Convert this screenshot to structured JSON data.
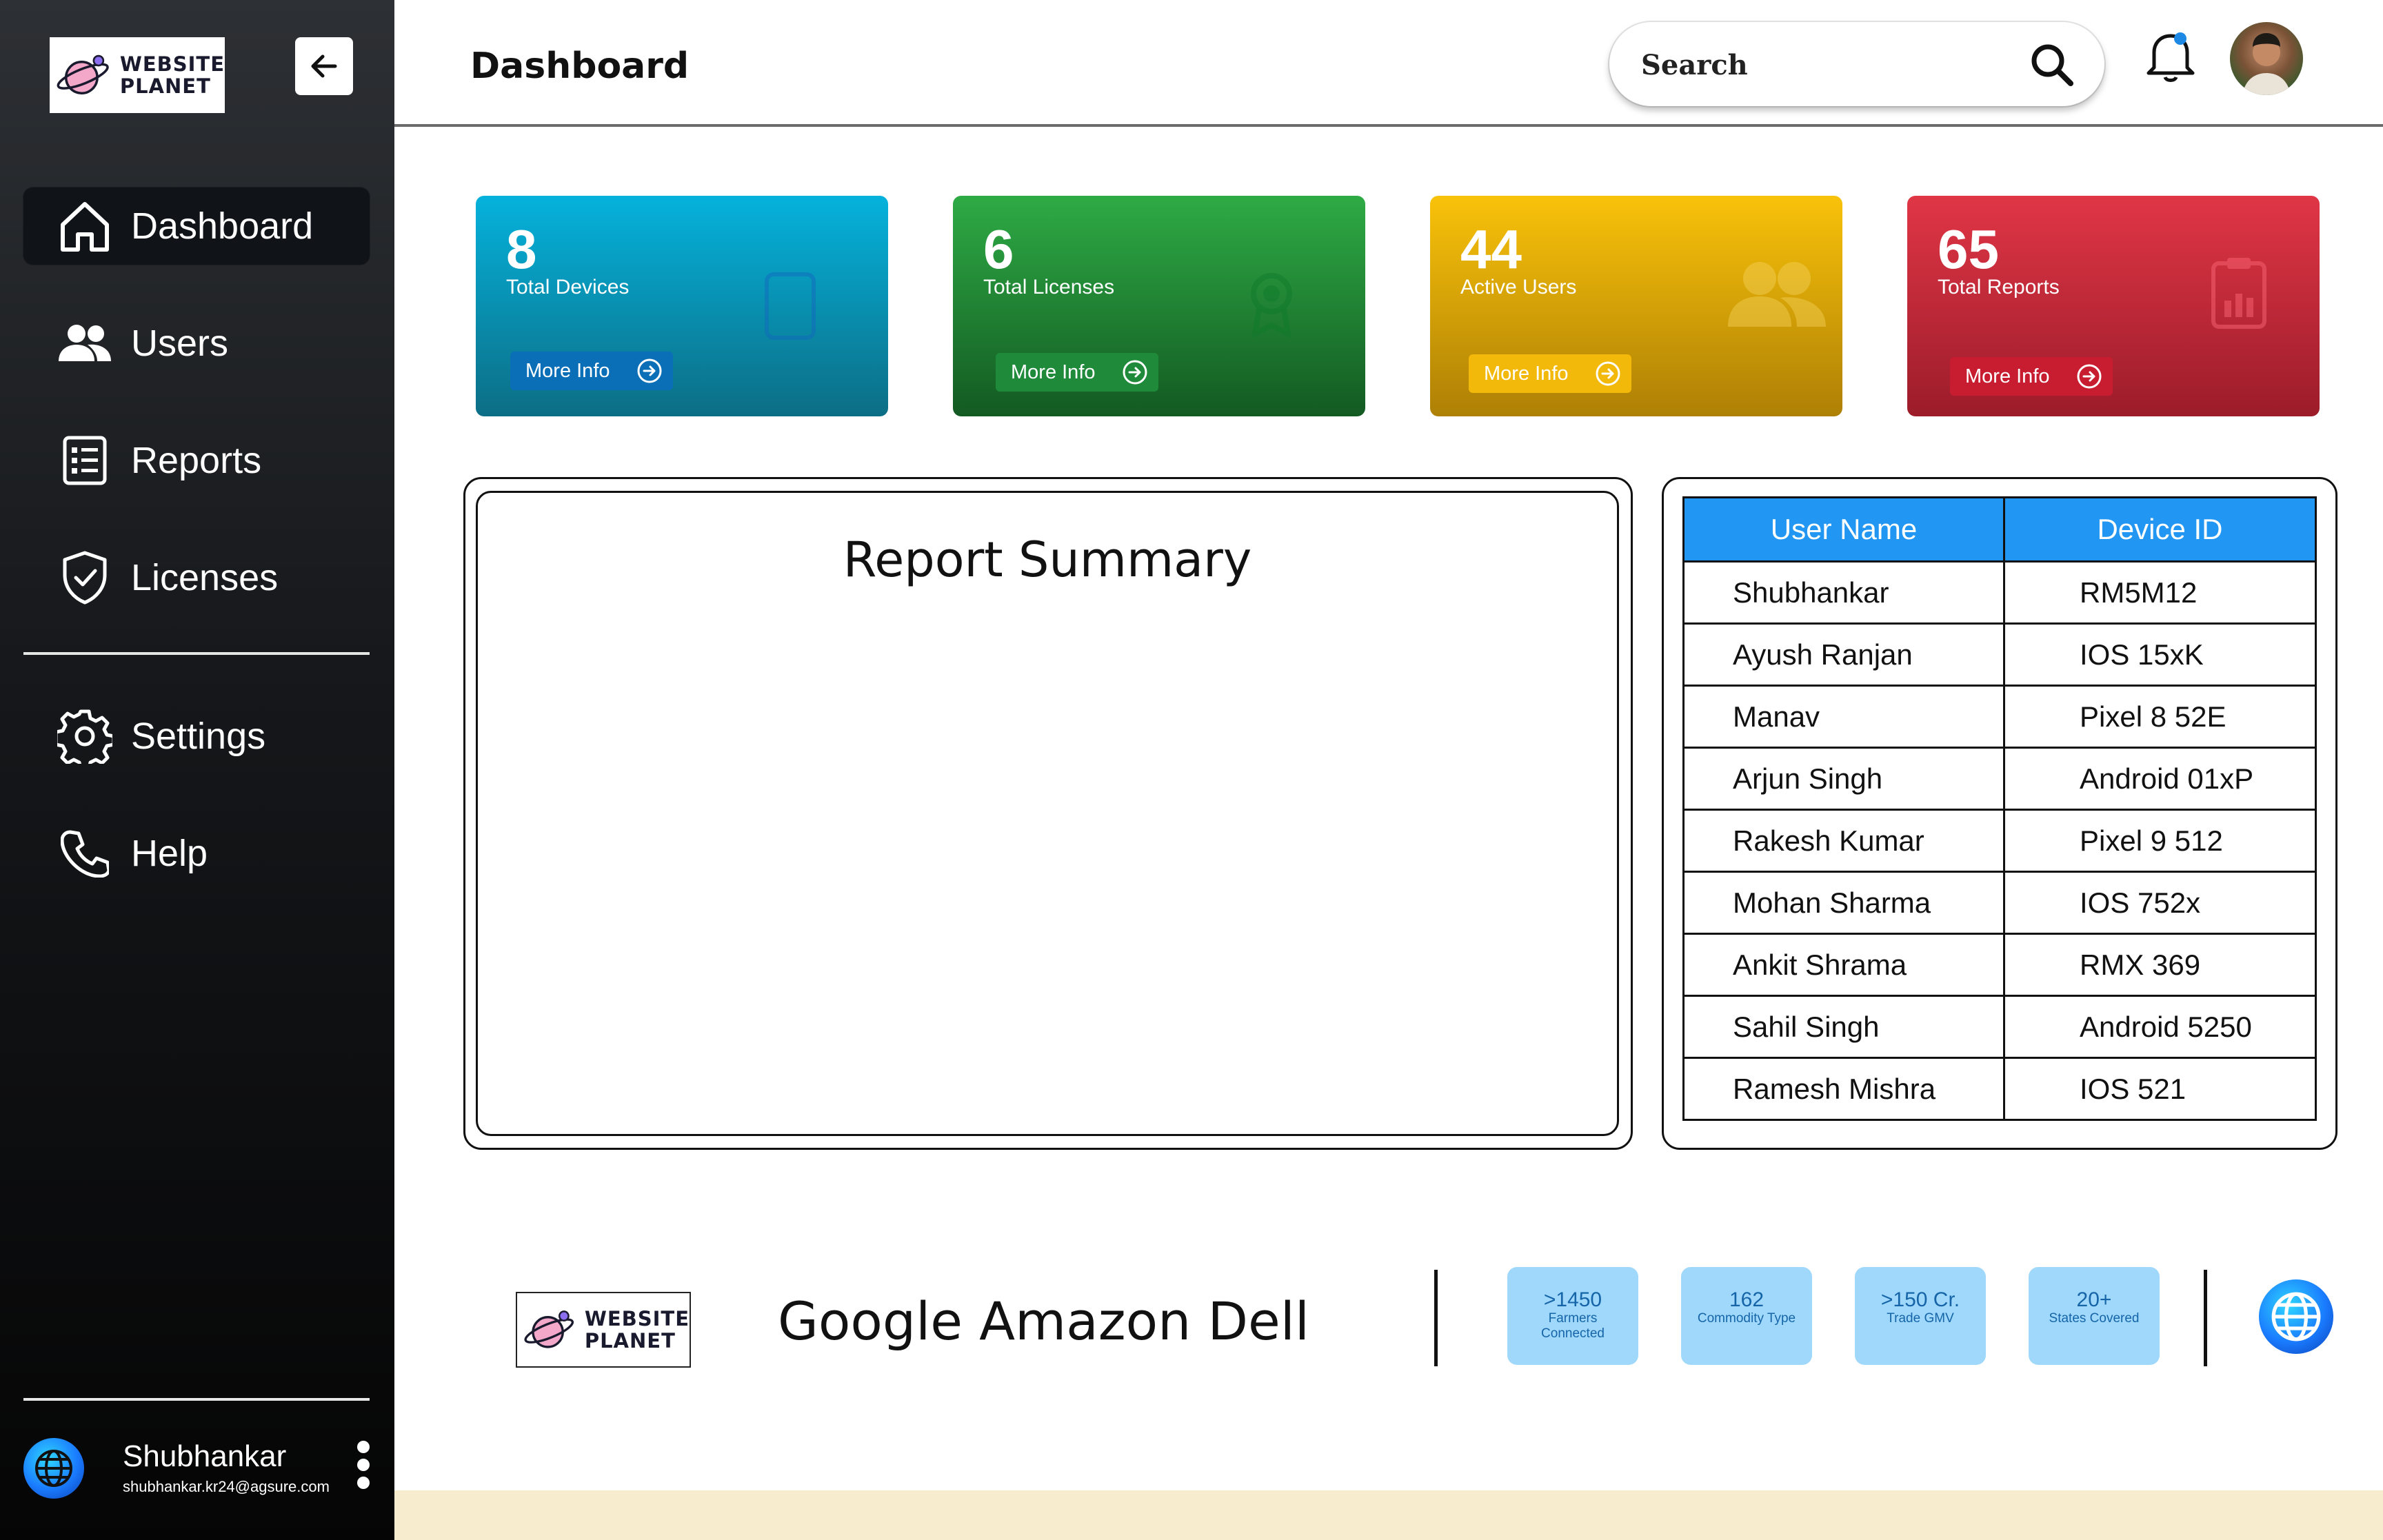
{
  "sidebar": {
    "logo_text": "WEBSITE\nPLANET",
    "nav": [
      {
        "label": "Dashboard",
        "icon": "home-icon",
        "active": true
      },
      {
        "label": "Users",
        "icon": "users-icon"
      },
      {
        "label": "Reports",
        "icon": "reports-icon"
      },
      {
        "label": "Licenses",
        "icon": "shield-icon"
      },
      {
        "label": "Settings",
        "icon": "gear-icon"
      },
      {
        "label": "Help",
        "icon": "phone-icon"
      }
    ],
    "user": {
      "name": "Shubhankar",
      "email": "shubhankar.kr24@agsure.com"
    }
  },
  "header": {
    "title": "Dashboard",
    "search_placeholder": "Search"
  },
  "cards": [
    {
      "value": "8",
      "label": "Total Devices",
      "more": "More Info",
      "color_top": "#05b2dc",
      "color_bottom": "#0c6e85",
      "btn": "#0b6fb7"
    },
    {
      "value": "6",
      "label": "Total Licenses",
      "more": "More Info",
      "color_top": "#2eab45",
      "color_bottom": "#135a22",
      "btn": "#1f8a3a"
    },
    {
      "value": "44",
      "label": "Active Users",
      "more": "More Info",
      "color_top": "#f9c20a",
      "color_bottom": "#ae8005",
      "btn": "#f2b90a"
    },
    {
      "value": "65",
      "label": "Total Reports",
      "more": "More Info",
      "color_top": "#e03646",
      "color_bottom": "#9c1c2a",
      "btn": "#c81d30"
    }
  ],
  "report_summary": {
    "title": "Report  Summary"
  },
  "user_table": {
    "headers": [
      "User Name",
      "Device ID"
    ],
    "rows": [
      [
        "Shubhankar",
        "RM5M12"
      ],
      [
        "Ayush Ranjan",
        "IOS 15xK"
      ],
      [
        "Manav",
        "Pixel 8 52E"
      ],
      [
        "Arjun Singh",
        "Android 01xP"
      ],
      [
        "Rakesh Kumar",
        "Pixel 9 512"
      ],
      [
        "Mohan Sharma",
        "IOS 752x"
      ],
      [
        "Ankit Shrama",
        "RMX 369"
      ],
      [
        "Sahil Singh",
        "Android 5250"
      ],
      [
        "Ramesh Mishra",
        "IOS 521"
      ]
    ]
  },
  "footer": {
    "logo_text": "WEBSITE\nPLANET",
    "partners": "Google Amazon Dell",
    "stats": [
      {
        "value": ">1450",
        "label": "Farmers\nConnected"
      },
      {
        "value": "162",
        "label": "Commodity Type"
      },
      {
        "value": ">150 Cr.",
        "label": "Trade GMV"
      },
      {
        "value": "20+",
        "label": "States Covered"
      }
    ]
  },
  "colors": {
    "accent": "#2196f3",
    "stat_bg": "#9fd8fb",
    "notification_dot": "#1e88e5"
  }
}
